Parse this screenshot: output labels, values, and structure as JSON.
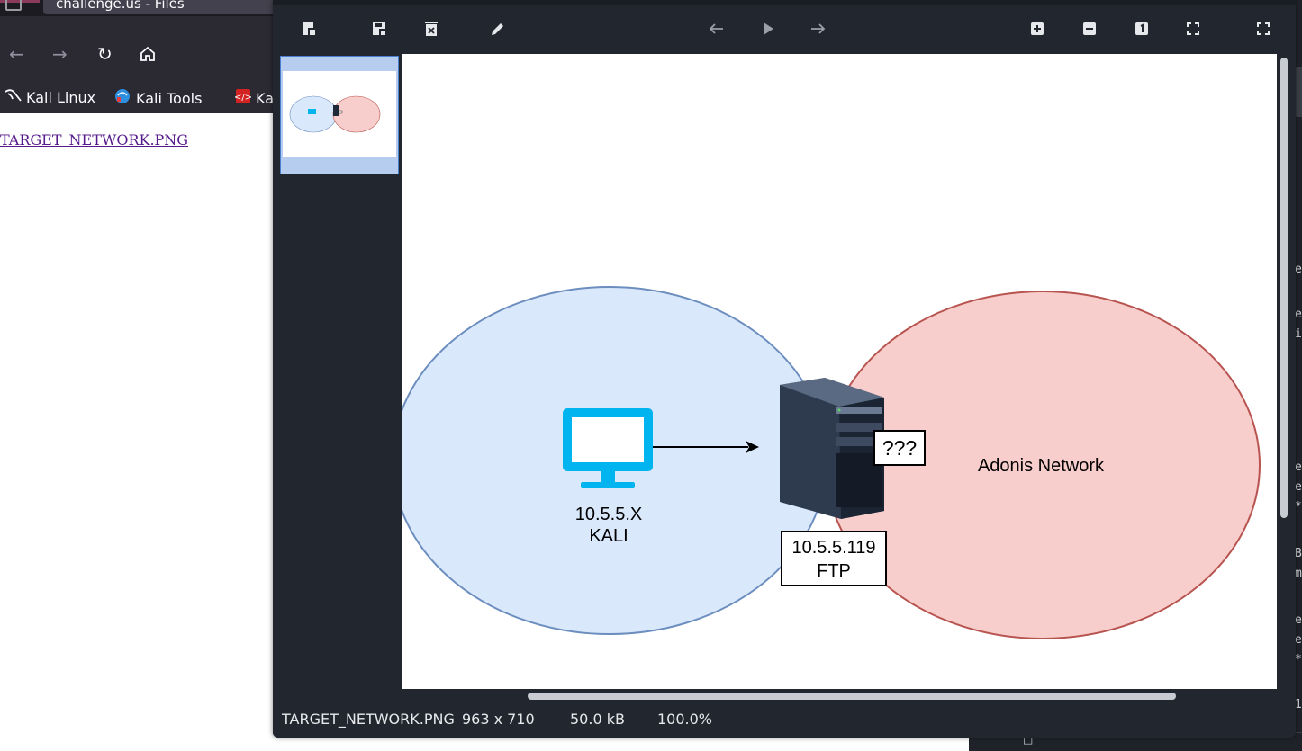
{
  "browser": {
    "tab_title": "challenge.us - Files",
    "bookmarks": [
      {
        "label": "Kali Linux",
        "icon": "kali-dragon-icon"
      },
      {
        "label": "Kali Tools",
        "icon": "kali-tools-icon"
      },
      {
        "label": "Ka",
        "icon": "exploit-db-icon"
      }
    ],
    "file_link": "TARGET_NETWORK.PNG"
  },
  "viewer": {
    "toolbar": {
      "left_buttons": [
        "open-icon",
        "save-icon",
        "delete-icon",
        "edit-icon"
      ],
      "nav_buttons": [
        "previous-icon",
        "slideshow-icon",
        "next-icon"
      ],
      "zoom_buttons": [
        "zoom-in-icon",
        "zoom-out-icon",
        "zoom-actual-size-icon",
        "zoom-fit-icon",
        "fullscreen-icon"
      ]
    },
    "status": {
      "filename": "TARGET_NETWORK.PNG",
      "dimensions": "963 x 710",
      "size": "50.0 kB",
      "zoom": "100.0%"
    }
  },
  "diagram": {
    "kali_ip": "10.5.5.X",
    "kali_name": "KALI",
    "ftp_ip": "10.5.5.119",
    "ftp_name": "FTP",
    "unknown_label": "???",
    "network_label": "Adonis Network",
    "colors": {
      "kali_fill": "#dae8fc",
      "kali_stroke": "#6c8ebf",
      "adonis_fill": "#f8cecc",
      "adonis_stroke": "#b85450",
      "monitor": "#00b4f0"
    }
  }
}
